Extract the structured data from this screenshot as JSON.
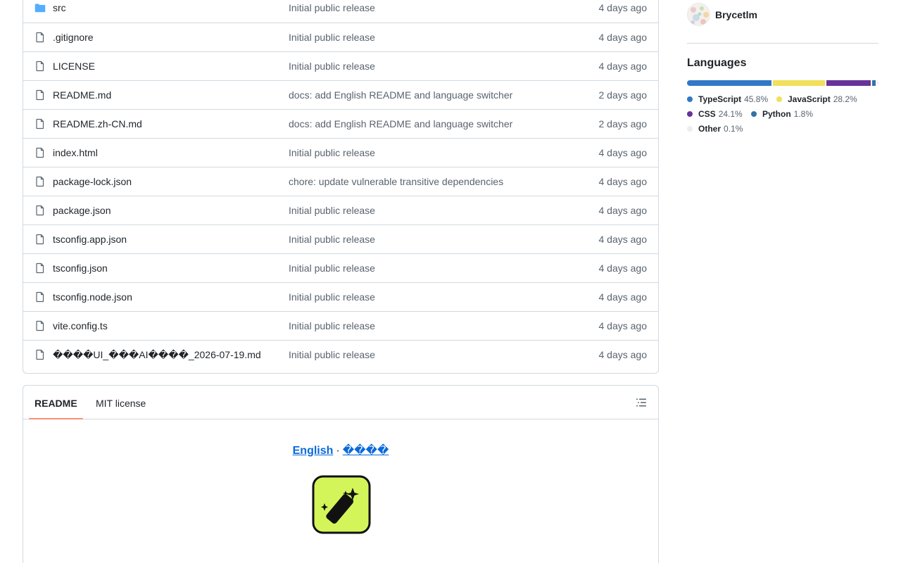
{
  "files": [
    {
      "name": "src",
      "type": "folder",
      "message": "Initial public release",
      "date": "4 days ago"
    },
    {
      "name": ".gitignore",
      "type": "file",
      "message": "Initial public release",
      "date": "4 days ago"
    },
    {
      "name": "LICENSE",
      "type": "file",
      "message": "Initial public release",
      "date": "4 days ago"
    },
    {
      "name": "README.md",
      "type": "file",
      "message": "docs: add English README and language switcher",
      "date": "2 days ago"
    },
    {
      "name": "README.zh-CN.md",
      "type": "file",
      "message": "docs: add English README and language switcher",
      "date": "2 days ago"
    },
    {
      "name": "index.html",
      "type": "file",
      "message": "Initial public release",
      "date": "4 days ago"
    },
    {
      "name": "package-lock.json",
      "type": "file",
      "message": "chore: update vulnerable transitive dependencies",
      "date": "4 days ago"
    },
    {
      "name": "package.json",
      "type": "file",
      "message": "Initial public release",
      "date": "4 days ago"
    },
    {
      "name": "tsconfig.app.json",
      "type": "file",
      "message": "Initial public release",
      "date": "4 days ago"
    },
    {
      "name": "tsconfig.json",
      "type": "file",
      "message": "Initial public release",
      "date": "4 days ago"
    },
    {
      "name": "tsconfig.node.json",
      "type": "file",
      "message": "Initial public release",
      "date": "4 days ago"
    },
    {
      "name": "vite.config.ts",
      "type": "file",
      "message": "Initial public release",
      "date": "4 days ago"
    },
    {
      "name": "����UI_���AI����_2026-07-19.md",
      "type": "file",
      "message": "Initial public release",
      "date": "4 days ago"
    }
  ],
  "readme": {
    "tabs": {
      "readme": "README",
      "license": "MIT license"
    },
    "lang_english": "English",
    "lang_separator": "·",
    "lang_chinese": "����"
  },
  "sidebar": {
    "contributor_name": "Brycetlm",
    "languages_title": "Languages",
    "languages": [
      {
        "name": "TypeScript",
        "percent": "45.8%",
        "value": 45.8,
        "color": "#3178c6"
      },
      {
        "name": "JavaScript",
        "percent": "28.2%",
        "value": 28.2,
        "color": "#f1e05a"
      },
      {
        "name": "CSS",
        "percent": "24.1%",
        "value": 24.1,
        "color": "#663399"
      },
      {
        "name": "Python",
        "percent": "1.8%",
        "value": 1.8,
        "color": "#3572A5"
      },
      {
        "name": "Other",
        "percent": "0.1%",
        "value": 0.1,
        "color": "#ededed"
      }
    ]
  },
  "icons": {
    "folder": "folder-icon",
    "file": "file-icon",
    "outline": "list-outline-icon",
    "logo": "magic-wand-app-logo"
  },
  "colors": {
    "link": "#0969da",
    "folder": "#54aeff",
    "tab_accent": "#fd8c73",
    "logo_bg": "#d4f55a"
  }
}
